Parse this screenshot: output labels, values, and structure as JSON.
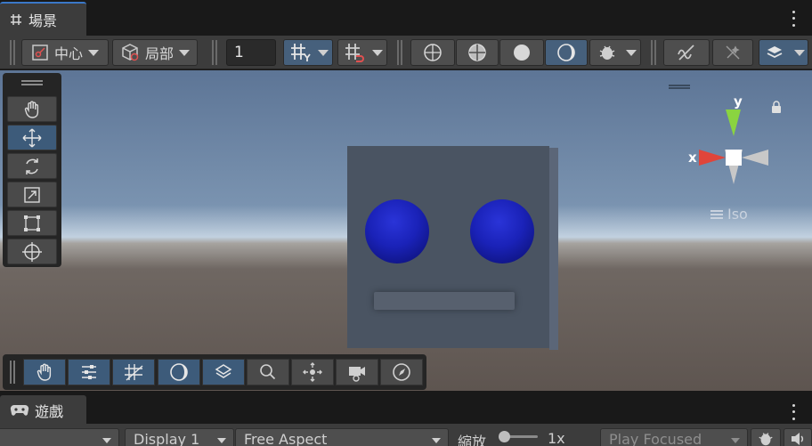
{
  "scene_tab": {
    "label": "場景",
    "icon": "grid-hash-icon"
  },
  "toolbar": {
    "pivot_mode": "中心",
    "pivot_rotation": "局部",
    "grid_size": "1"
  },
  "game_tab": {
    "label": "遊戲",
    "icon": "gamepad-icon"
  },
  "game_toolbar": {
    "display": "Display 1",
    "aspect": "Free Aspect",
    "scale_label": "縮放",
    "scale_value": "1x",
    "play_mode": "Play Focused"
  },
  "gizmo": {
    "y_label": "y",
    "x_label": "x",
    "projection": "Iso"
  },
  "colors": {
    "accent": "#3a78c8",
    "active_button": "#46607c",
    "eye": "#1a22b8",
    "face": "#4a5462"
  }
}
